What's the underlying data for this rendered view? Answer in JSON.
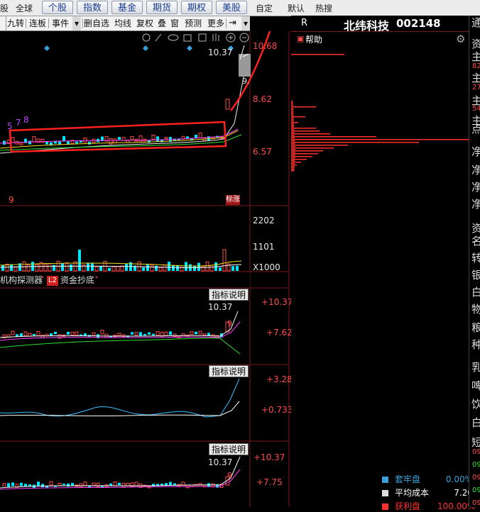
{
  "top_tabs": [
    "全球",
    "个股",
    "指数",
    "基金",
    "期货",
    "期权",
    "美股"
  ],
  "top_extra": {
    "edge_label": "股",
    "selfpick": "自定",
    "default": "默认",
    "hot": "热搜"
  },
  "toolbar": {
    "items": [
      "九转",
      "连板",
      "事件"
    ],
    "items2": [
      "删自选",
      "均线",
      "复权",
      "叠",
      "窗",
      "预测",
      "更多"
    ]
  },
  "main_chart": {
    "price_labels": [
      "10.68",
      "8.62",
      "6.57"
    ],
    "last_price": "10.37",
    "partial_price": "9.",
    "counter_digits": [
      "5",
      "7",
      "8"
    ],
    "bottom_left": "9",
    "zt_tag": "标涨"
  },
  "volume": {
    "labels": [
      "2202",
      "1101",
      "X1000"
    ]
  },
  "indicator_tabs": {
    "jigou": "机构探测器",
    "l2": "L2",
    "zijin": "资金抄底"
  },
  "ind1": {
    "btn": "指标说明",
    "price": "10.37",
    "top": "+10.37",
    "mid": "+7.62",
    "mark": "9"
  },
  "ind2": {
    "btn": "指标说明",
    "top": "+3.28",
    "mid": "+0.733"
  },
  "ind3": {
    "btn": "指标说明",
    "price": "10.37",
    "top": "+10.37",
    "mid": "+7.75",
    "mark": "9"
  },
  "stock": {
    "r_label": "R",
    "name": "北纬科技",
    "code": "002148",
    "help": "帮助"
  },
  "legend": [
    {
      "label": "套牢盘",
      "value": "0.00%",
      "color": "#3aa0d8"
    },
    {
      "label": "平均成本",
      "value": "7.20",
      "color": "#dddddd"
    },
    {
      "label": "获利盘",
      "value": "100.00%",
      "color": "#ff3030"
    }
  ],
  "far_right_chars": [
    "通",
    "资",
    "主",
    "82",
    "主",
    "27",
    "主",
    "54",
    "主",
    "点",
    "净",
    "净",
    "净",
    "净",
    "资",
    "名",
    "转",
    "银",
    "白",
    "物",
    "粮",
    "种",
    "乳",
    "啤",
    "饮",
    "白",
    "短",
    "09",
    "09",
    "09",
    "09",
    "09"
  ],
  "colors": {
    "accent_red": "#ff4b4b",
    "box_red": "#ff2020",
    "cyan": "#00e5ff",
    "panel_border": "#7a1a1a"
  }
}
